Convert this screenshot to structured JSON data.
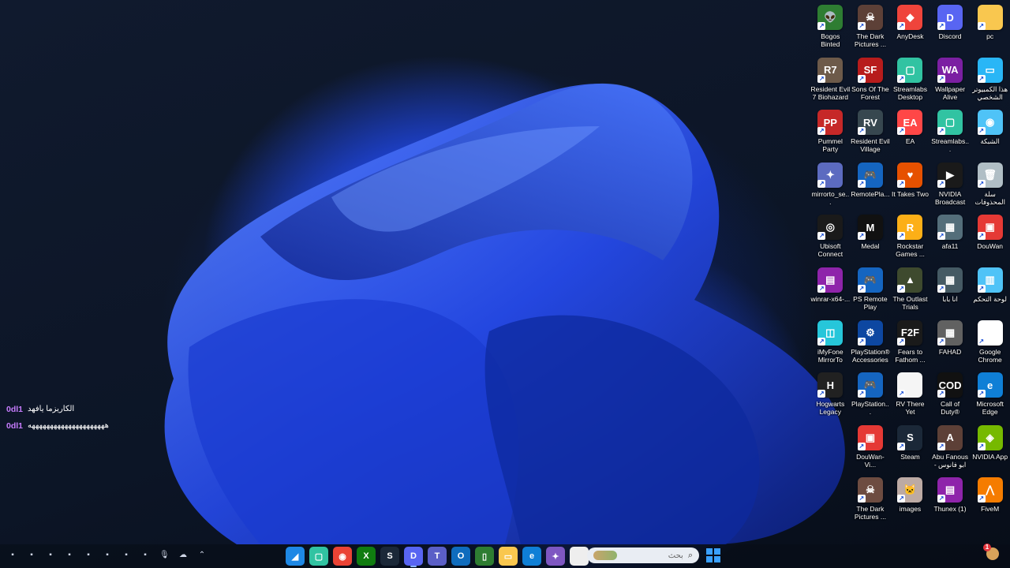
{
  "colors": {
    "accent": "#1f44d8",
    "chat_username": "#c77dff",
    "taskbar": "#080c16"
  },
  "desktop_icons": [
    {
      "label": "Bogos Binted",
      "icon": "alien-icon",
      "bg": "#2e7d32",
      "glyph": "👽"
    },
    {
      "label": "Resident Evil 7 Biohazard",
      "icon": "re7-icon",
      "bg": "#6d5a4a",
      "glyph": "R7"
    },
    {
      "label": "Pummel Party",
      "icon": "pummel-party-icon",
      "bg": "#c62828",
      "glyph": "PP"
    },
    {
      "label": "mirrorto_se...",
      "icon": "puzzle-icon",
      "bg": "#5c6bc0",
      "glyph": "✦"
    },
    {
      "label": "Ubisoft Connect",
      "icon": "ubisoft-icon",
      "bg": "#1a1a1a",
      "glyph": "◎"
    },
    {
      "label": "winrar-x64-...",
      "icon": "winrar-icon",
      "bg": "#8e24aa",
      "glyph": "▤"
    },
    {
      "label": "iMyFone MirrorTo",
      "icon": "imyfone-icon",
      "bg": "#26c6da",
      "glyph": "◫"
    },
    {
      "label": "Hogwarts Legacy",
      "icon": "hogwarts-icon",
      "bg": "#212121",
      "glyph": "H"
    },
    {
      "label": "",
      "icon": "empty",
      "bg": "transparent",
      "glyph": ""
    },
    {
      "label": "",
      "icon": "empty",
      "bg": "transparent",
      "glyph": ""
    },
    {
      "label": "The Dark Pictures ...",
      "icon": "dark-pictures-icon",
      "bg": "#5d4037",
      "glyph": "☠"
    },
    {
      "label": "Sons Of The Forest",
      "icon": "sons-forest-icon",
      "bg": "#b71c1c",
      "glyph": "SF"
    },
    {
      "label": "Resident Evil Village",
      "icon": "re-village-icon",
      "bg": "#37474f",
      "glyph": "RV"
    },
    {
      "label": "RemotePla...",
      "icon": "remote-play-icon",
      "bg": "#1565c0",
      "glyph": "🎮"
    },
    {
      "label": "Medal",
      "icon": "medal-icon",
      "bg": "#111111",
      "glyph": "M"
    },
    {
      "label": "PS Remote Play",
      "icon": "ps-remote-icon",
      "bg": "#1565c0",
      "glyph": "🎮"
    },
    {
      "label": "PlayStation® Accessories",
      "icon": "ps-accessories-icon",
      "bg": "#0d47a1",
      "glyph": "⚙"
    },
    {
      "label": "PlayStation...",
      "icon": "playstation-icon",
      "bg": "#1565c0",
      "glyph": "🎮"
    },
    {
      "label": "DouWan-Vi...",
      "icon": "douwan-vi-icon",
      "bg": "#e53935",
      "glyph": "▣"
    },
    {
      "label": "The Dark Pictures ...",
      "icon": "dark-pictures-2-icon",
      "bg": "#6d4c41",
      "glyph": "☠"
    },
    {
      "label": "AnyDesk",
      "icon": "anydesk-icon",
      "bg": "#ef443b",
      "glyph": "◆"
    },
    {
      "label": "Streamlabs Desktop",
      "icon": "streamlabs-icon",
      "bg": "#31c3a2",
      "glyph": "▢"
    },
    {
      "label": "EA",
      "icon": "ea-icon",
      "bg": "#ff4747",
      "glyph": "EA"
    },
    {
      "label": "It Takes Two",
      "icon": "it-takes-two-icon",
      "bg": "#e65100",
      "glyph": "♥"
    },
    {
      "label": "Rockstar Games ...",
      "icon": "rockstar-icon",
      "bg": "#fcaf17",
      "glyph": "R"
    },
    {
      "label": "The Outlast Trials",
      "icon": "outlast-icon",
      "bg": "#3e4a2e",
      "glyph": "▲"
    },
    {
      "label": "Fears to Fathom ...",
      "icon": "fears-fathom-icon",
      "bg": "#1a1a1a",
      "glyph": "F2F"
    },
    {
      "label": "RV There Yet",
      "icon": "document-icon",
      "bg": "#f5f5f5",
      "glyph": ""
    },
    {
      "label": "Steam",
      "icon": "steam-icon",
      "bg": "#1b2838",
      "glyph": "S"
    },
    {
      "label": "images",
      "icon": "image-icon",
      "bg": "#bcaaa4",
      "glyph": "🐱"
    },
    {
      "label": "Discord",
      "icon": "discord-icon",
      "bg": "#5865f2",
      "glyph": "D"
    },
    {
      "label": "Wallpaper Alive",
      "icon": "wallpaper-alive-icon",
      "bg": "#7b1fa2",
      "glyph": "WA"
    },
    {
      "label": "Streamlabs...",
      "icon": "streamlabs-2-icon",
      "bg": "#31c3a2",
      "glyph": "▢"
    },
    {
      "label": "NVIDIA Broadcast",
      "icon": "nvidia-broadcast-icon",
      "bg": "#1a1a1a",
      "glyph": "▶"
    },
    {
      "label": "afa11",
      "icon": "video-file-icon",
      "bg": "#546e7a",
      "glyph": "▦"
    },
    {
      "label": "انا بابا",
      "icon": "video-file-2-icon",
      "bg": "#455a64",
      "glyph": "▦"
    },
    {
      "label": "FAHAD",
      "icon": "video-file-3-icon",
      "bg": "#616161",
      "glyph": "▦"
    },
    {
      "label": "Call of Duty®",
      "icon": "cod-icon",
      "bg": "#111111",
      "glyph": "COD"
    },
    {
      "label": "Abu Fanous - ابو فانوس",
      "icon": "abu-fanous-icon",
      "bg": "#5d4037",
      "glyph": "A"
    },
    {
      "label": "Thunex (1)",
      "icon": "winrar-2-icon",
      "bg": "#8e24aa",
      "glyph": "▤"
    },
    {
      "label": "pc",
      "icon": "folder-icon",
      "bg": "#f9c74f",
      "glyph": ""
    },
    {
      "label": "هذا الكمبيوتر الشخصي",
      "icon": "this-pc-icon",
      "bg": "#29b6f6",
      "glyph": "▭"
    },
    {
      "label": "الشبكة",
      "icon": "network-icon",
      "bg": "#4fc3f7",
      "glyph": "◉"
    },
    {
      "label": "سلة المحذوفات",
      "icon": "recycle-bin-icon",
      "bg": "#b0bec5",
      "glyph": "🗑"
    },
    {
      "label": "DouWan",
      "icon": "douwan-icon",
      "bg": "#e53935",
      "glyph": "▣"
    },
    {
      "label": "لوحة التحكم",
      "icon": "control-panel-icon",
      "bg": "#4fc3f7",
      "glyph": "▥"
    },
    {
      "label": "Google Chrome",
      "icon": "chrome-icon",
      "bg": "#ffffff",
      "glyph": "◉"
    },
    {
      "label": "Microsoft Edge",
      "icon": "edge-icon",
      "bg": "#0f7fd6",
      "glyph": "e"
    },
    {
      "label": "NVIDIA App",
      "icon": "nvidia-app-icon",
      "bg": "#76b900",
      "glyph": "◈"
    },
    {
      "label": "FiveM",
      "icon": "fivem-icon",
      "bg": "#f57c00",
      "glyph": "⋀"
    }
  ],
  "chat": {
    "messages": [
      {
        "user": "0dl1",
        "text": "الكاريزما يافهد"
      },
      {
        "user": "0dl1",
        "text": "هههههههههههههههههههههه"
      }
    ]
  },
  "taskbar": {
    "apps": [
      {
        "name": "vpn-icon",
        "bg": "#1e88e5",
        "glyph": "◢"
      },
      {
        "name": "streamlabs-taskbar-icon",
        "bg": "#31c3a2",
        "glyph": "▢"
      },
      {
        "name": "chrome-taskbar-icon",
        "bg": "#ea4335",
        "glyph": "◉"
      },
      {
        "name": "xbox-icon",
        "bg": "#107c10",
        "glyph": "X"
      },
      {
        "name": "steam-taskbar-icon",
        "bg": "#1b2838",
        "glyph": "S"
      },
      {
        "name": "discord-taskbar-icon",
        "bg": "#5865f2",
        "glyph": "D",
        "active": true
      },
      {
        "name": "teams-icon",
        "bg": "#5b5fc7",
        "glyph": "T"
      },
      {
        "name": "outlook-icon",
        "bg": "#0f6cbd",
        "glyph": "O"
      },
      {
        "name": "phone-link-icon",
        "bg": "#2e7d32",
        "glyph": "▯"
      },
      {
        "name": "file-explorer-icon",
        "bg": "#f9c74f",
        "glyph": "▭"
      },
      {
        "name": "edge-taskbar-icon",
        "bg": "#0f7fd6",
        "glyph": "e"
      },
      {
        "name": "copilot-icon",
        "bg": "#7e57c2",
        "glyph": "✦"
      },
      {
        "name": "notepad-icon",
        "bg": "#eeeeee",
        "glyph": ""
      }
    ],
    "search_placeholder": "بحث"
  },
  "notification_count": "1"
}
